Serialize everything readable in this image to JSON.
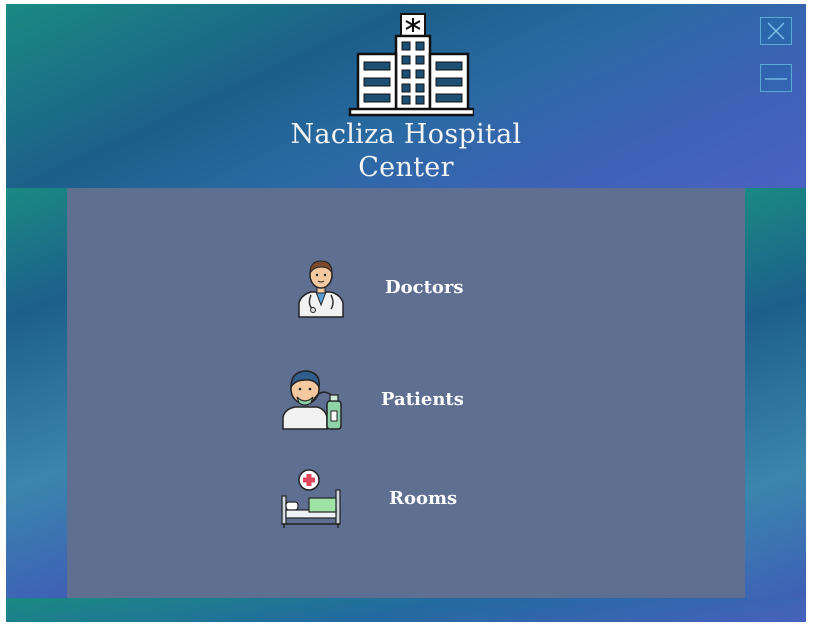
{
  "app": {
    "title_line1": "Nacliza Hospital",
    "title_line2": "Center"
  },
  "window_controls": {
    "close_icon": "close-icon",
    "minimize_icon": "minimize-icon"
  },
  "menu": {
    "items": [
      {
        "label": "Doctors",
        "icon": "doctor-icon"
      },
      {
        "label": "Patients",
        "icon": "patient-icon"
      },
      {
        "label": "Rooms",
        "icon": "hospital-bed-icon"
      }
    ]
  },
  "colors": {
    "content_background": "#5f6f91",
    "header_teal": "#1a8a82",
    "header_blue": "#4a63c2",
    "text": "#ffffff"
  }
}
